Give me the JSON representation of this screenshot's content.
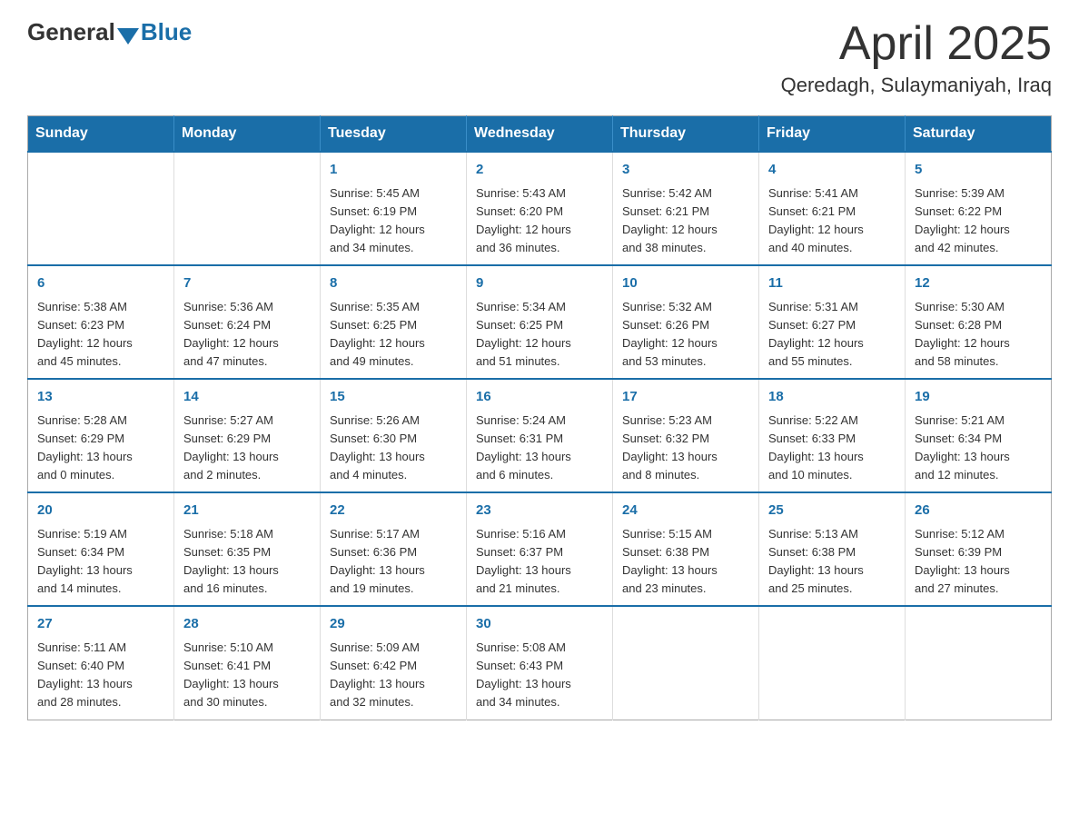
{
  "logo": {
    "general": "General",
    "blue": "Blue"
  },
  "title": "April 2025",
  "location": "Qeredagh, Sulaymaniyah, Iraq",
  "days_of_week": [
    "Sunday",
    "Monday",
    "Tuesday",
    "Wednesday",
    "Thursday",
    "Friday",
    "Saturday"
  ],
  "weeks": [
    [
      {
        "day": "",
        "info": ""
      },
      {
        "day": "",
        "info": ""
      },
      {
        "day": "1",
        "info": "Sunrise: 5:45 AM\nSunset: 6:19 PM\nDaylight: 12 hours\nand 34 minutes."
      },
      {
        "day": "2",
        "info": "Sunrise: 5:43 AM\nSunset: 6:20 PM\nDaylight: 12 hours\nand 36 minutes."
      },
      {
        "day": "3",
        "info": "Sunrise: 5:42 AM\nSunset: 6:21 PM\nDaylight: 12 hours\nand 38 minutes."
      },
      {
        "day": "4",
        "info": "Sunrise: 5:41 AM\nSunset: 6:21 PM\nDaylight: 12 hours\nand 40 minutes."
      },
      {
        "day": "5",
        "info": "Sunrise: 5:39 AM\nSunset: 6:22 PM\nDaylight: 12 hours\nand 42 minutes."
      }
    ],
    [
      {
        "day": "6",
        "info": "Sunrise: 5:38 AM\nSunset: 6:23 PM\nDaylight: 12 hours\nand 45 minutes."
      },
      {
        "day": "7",
        "info": "Sunrise: 5:36 AM\nSunset: 6:24 PM\nDaylight: 12 hours\nand 47 minutes."
      },
      {
        "day": "8",
        "info": "Sunrise: 5:35 AM\nSunset: 6:25 PM\nDaylight: 12 hours\nand 49 minutes."
      },
      {
        "day": "9",
        "info": "Sunrise: 5:34 AM\nSunset: 6:25 PM\nDaylight: 12 hours\nand 51 minutes."
      },
      {
        "day": "10",
        "info": "Sunrise: 5:32 AM\nSunset: 6:26 PM\nDaylight: 12 hours\nand 53 minutes."
      },
      {
        "day": "11",
        "info": "Sunrise: 5:31 AM\nSunset: 6:27 PM\nDaylight: 12 hours\nand 55 minutes."
      },
      {
        "day": "12",
        "info": "Sunrise: 5:30 AM\nSunset: 6:28 PM\nDaylight: 12 hours\nand 58 minutes."
      }
    ],
    [
      {
        "day": "13",
        "info": "Sunrise: 5:28 AM\nSunset: 6:29 PM\nDaylight: 13 hours\nand 0 minutes."
      },
      {
        "day": "14",
        "info": "Sunrise: 5:27 AM\nSunset: 6:29 PM\nDaylight: 13 hours\nand 2 minutes."
      },
      {
        "day": "15",
        "info": "Sunrise: 5:26 AM\nSunset: 6:30 PM\nDaylight: 13 hours\nand 4 minutes."
      },
      {
        "day": "16",
        "info": "Sunrise: 5:24 AM\nSunset: 6:31 PM\nDaylight: 13 hours\nand 6 minutes."
      },
      {
        "day": "17",
        "info": "Sunrise: 5:23 AM\nSunset: 6:32 PM\nDaylight: 13 hours\nand 8 minutes."
      },
      {
        "day": "18",
        "info": "Sunrise: 5:22 AM\nSunset: 6:33 PM\nDaylight: 13 hours\nand 10 minutes."
      },
      {
        "day": "19",
        "info": "Sunrise: 5:21 AM\nSunset: 6:34 PM\nDaylight: 13 hours\nand 12 minutes."
      }
    ],
    [
      {
        "day": "20",
        "info": "Sunrise: 5:19 AM\nSunset: 6:34 PM\nDaylight: 13 hours\nand 14 minutes."
      },
      {
        "day": "21",
        "info": "Sunrise: 5:18 AM\nSunset: 6:35 PM\nDaylight: 13 hours\nand 16 minutes."
      },
      {
        "day": "22",
        "info": "Sunrise: 5:17 AM\nSunset: 6:36 PM\nDaylight: 13 hours\nand 19 minutes."
      },
      {
        "day": "23",
        "info": "Sunrise: 5:16 AM\nSunset: 6:37 PM\nDaylight: 13 hours\nand 21 minutes."
      },
      {
        "day": "24",
        "info": "Sunrise: 5:15 AM\nSunset: 6:38 PM\nDaylight: 13 hours\nand 23 minutes."
      },
      {
        "day": "25",
        "info": "Sunrise: 5:13 AM\nSunset: 6:38 PM\nDaylight: 13 hours\nand 25 minutes."
      },
      {
        "day": "26",
        "info": "Sunrise: 5:12 AM\nSunset: 6:39 PM\nDaylight: 13 hours\nand 27 minutes."
      }
    ],
    [
      {
        "day": "27",
        "info": "Sunrise: 5:11 AM\nSunset: 6:40 PM\nDaylight: 13 hours\nand 28 minutes."
      },
      {
        "day": "28",
        "info": "Sunrise: 5:10 AM\nSunset: 6:41 PM\nDaylight: 13 hours\nand 30 minutes."
      },
      {
        "day": "29",
        "info": "Sunrise: 5:09 AM\nSunset: 6:42 PM\nDaylight: 13 hours\nand 32 minutes."
      },
      {
        "day": "30",
        "info": "Sunrise: 5:08 AM\nSunset: 6:43 PM\nDaylight: 13 hours\nand 34 minutes."
      },
      {
        "day": "",
        "info": ""
      },
      {
        "day": "",
        "info": ""
      },
      {
        "day": "",
        "info": ""
      }
    ]
  ]
}
